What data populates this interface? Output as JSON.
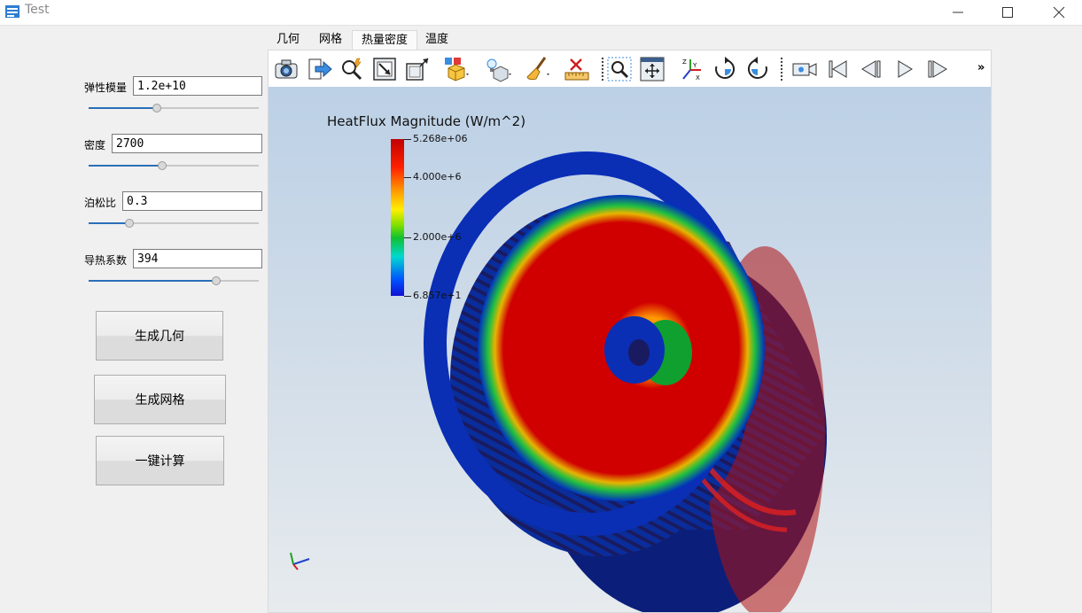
{
  "window": {
    "title": "Test"
  },
  "form": {
    "fields": [
      {
        "label": "弹性模量",
        "value": "1.2e+10",
        "slider": 0.4
      },
      {
        "label": "密度",
        "value": "2700",
        "slider": 0.43
      },
      {
        "label": "泊松比",
        "value": "0.3",
        "slider": 0.24
      },
      {
        "label": "导热系数",
        "value": "394",
        "slider": 0.75
      }
    ],
    "buttons": [
      "生成几何",
      "生成网格",
      "一键计算"
    ]
  },
  "tabs": [
    "几何",
    "网格",
    "热量密度",
    "温度"
  ],
  "active_tab": "热量密度",
  "toolbar": {
    "icons": [
      "camera-icon",
      "export-icon",
      "query-icon",
      "reset-view-icon",
      "box-icon",
      "color-select-icon",
      "light-icon",
      "brush-icon",
      "ruler-icon",
      "zoom-box-icon",
      "fit-view-icon",
      "axes-icon",
      "rotate-cw-icon",
      "rotate-ccw-icon",
      "record-icon",
      "first-frame-icon",
      "prev-frame-icon",
      "play-icon",
      "last-frame-icon"
    ],
    "more": "»"
  },
  "legend": {
    "title": "HeatFlux Magnitude (W/m^2)",
    "labels": [
      "5.268e+06",
      "4.000e+6",
      "2.000e+6",
      "6.857e+1"
    ],
    "values": [
      5268000,
      4000000,
      2000000,
      68.57
    ],
    "colors": {
      "max": "#c00000",
      "mid": "#ffee00",
      "min": "#1010d0"
    }
  }
}
